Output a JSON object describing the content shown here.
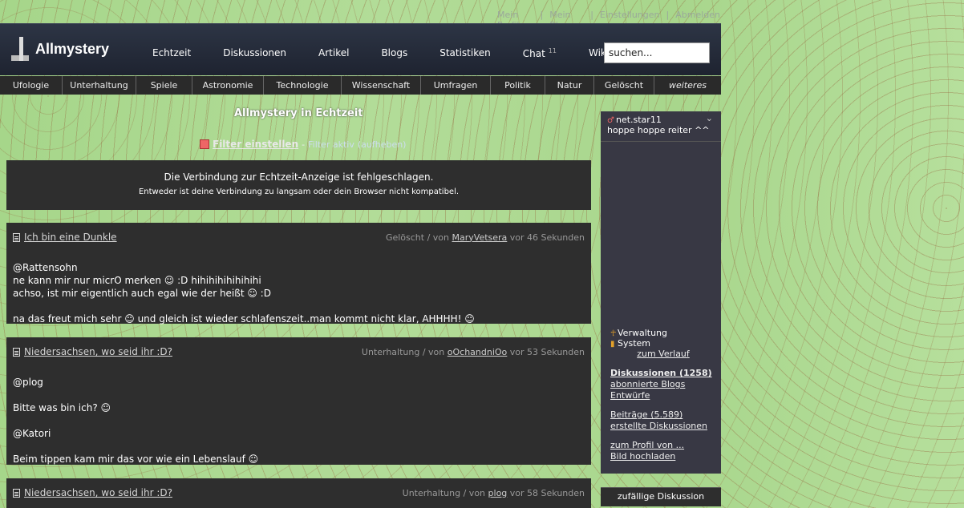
{
  "toplinks": [
    "Mein Profil",
    "Mein Blog",
    "Einstellungen",
    "Abmelden"
  ],
  "brand": "Allmystery",
  "nav": [
    "Echtzeit",
    "Diskussionen",
    "Artikel",
    "Blogs",
    "Statistiken",
    "Chat",
    "Wiki"
  ],
  "chat_count": "11",
  "search_placeholder": "suchen...",
  "categories": [
    "Ufologie",
    "Unterhaltung",
    "Spiele",
    "Astronomie",
    "Technologie",
    "Wissenschaft",
    "Umfragen",
    "Politik",
    "Natur",
    "Gelöscht",
    "weiteres"
  ],
  "page_title": "Allmystery in Echtzeit",
  "filter": {
    "link": "Filter einstellen",
    "status": "Filter aktiv",
    "cancel": "(aufheben)"
  },
  "error": {
    "line1": "Die Verbindung zur Echtzeit-Anzeige ist fehlgeschlagen.",
    "line2": "Entweder ist deine Verbindung zu langsam oder dein Browser nicht kompatibel."
  },
  "posts": [
    {
      "title": "Ich bin eine Dunkle",
      "category": "Gelöscht",
      "von": "/ von",
      "user": "MaryVetsera",
      "time": "vor 46 Sekunden",
      "lines": [
        "",
        "@Rattensohn",
        "ne kann mir nur micrO merken ☺ :D hihihihihihihihi",
        "achso, ist mir eigentlich auch egal wie der heißt ☺ :D",
        "",
        "na das freut mich sehr ☺ und gleich ist wieder schlafenszeit..man kommt nicht klar, AHHHH! ☺"
      ]
    },
    {
      "title": "Niedersachsen, wo seid ihr :D?",
      "category": "Unterhaltung",
      "von": "/ von",
      "user": "oOchandniOo",
      "time": "vor 53 Sekunden",
      "lines": [
        "",
        "@plog",
        "",
        "Bitte was bin ich? ☺",
        "",
        "@Katori",
        "",
        "Beim tippen kam mir das vor wie ein Lebenslauf ☺"
      ]
    },
    {
      "title": "Niedersachsen, wo seid ihr :D?",
      "category": "Unterhaltung",
      "von": "/ von",
      "user": "plog",
      "time": "vor 58 Sekunden",
      "lines": []
    }
  ],
  "sidebar": {
    "username": "net.star11",
    "status": "hoppe hoppe reiter ^^",
    "verwaltung": "Verwaltung",
    "system": "System",
    "verlauf": "zum Verlauf",
    "diskussionen": "Diskussionen (1258)",
    "blogs": "abonnierte Blogs",
    "entwuerfe": "Entwürfe",
    "beitraege": "Beiträge (5.589)",
    "erstellte": "erstellte Diskussionen",
    "profil": "zum Profil von ...",
    "bild": "Bild hochladen",
    "random": "zufällige Diskussion"
  }
}
